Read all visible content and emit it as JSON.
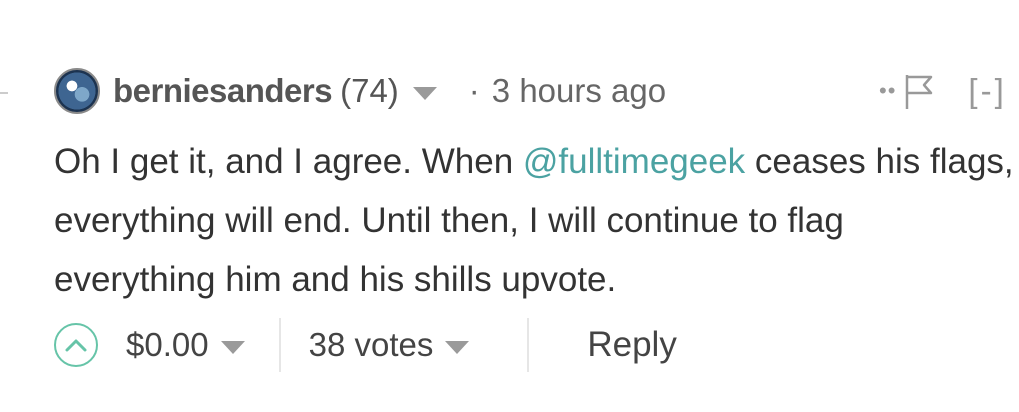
{
  "comment": {
    "author": "berniesanders",
    "reputation": "(74)",
    "separator": "·",
    "timestamp": "3 hours ago",
    "voters_glyph": "••",
    "collapse_label": "[-]",
    "body": {
      "part1": "Oh I get it, and I agree. When ",
      "mention": "@fulltimegeek",
      "part2": " ceases his flags, everything will end. Until then, I will continue to flag everything him and his shills upvote."
    },
    "footer": {
      "payout": "$0.00",
      "votes": "38 votes",
      "reply_label": "Reply"
    }
  },
  "colors": {
    "accent": "#4ba2a2",
    "upvote_border": "#66c4a8",
    "text": "#333333",
    "muted": "#999999"
  },
  "icons": [
    "avatar-globe",
    "dropdown-caret-icon",
    "voters-icon",
    "flag-icon",
    "upvote-chevron-icon"
  ]
}
